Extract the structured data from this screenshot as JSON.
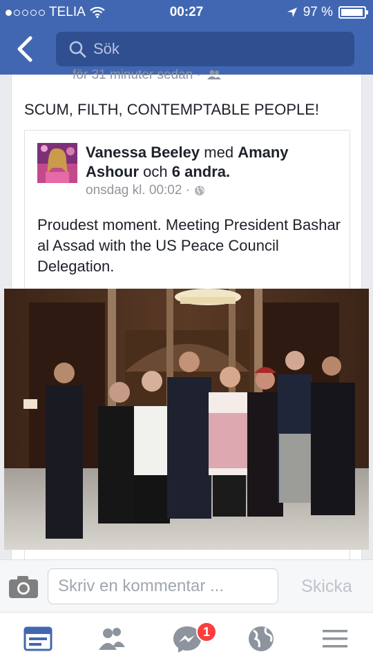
{
  "status_bar": {
    "carrier": "TELIA",
    "time": "00:27",
    "battery": "97 %",
    "battery_level": 0.97
  },
  "nav": {
    "search_placeholder": "Sök"
  },
  "post": {
    "timestamp": "för 31 minuter sedan ·",
    "text": "SCUM, FILTH, CONTEMPTABLE PEOPLE!",
    "shared": {
      "author": "Vanessa Beeley",
      "with_word": "med",
      "tagged_name": "Amany Ashour",
      "and_word": "och",
      "others": "6 andra",
      "time": "onsdag kl. 00:02 ·",
      "text": "Proudest moment. Meeting President Bashar al Assad with the US Peace Council Delegation."
    }
  },
  "comment_bar": {
    "placeholder": "Skriv en kommentar ...",
    "send_label": "Skicka"
  },
  "tabbar": {
    "messenger_badge": "1"
  },
  "colors": {
    "brand": "#4267b2",
    "badge": "#fa3e3e"
  }
}
